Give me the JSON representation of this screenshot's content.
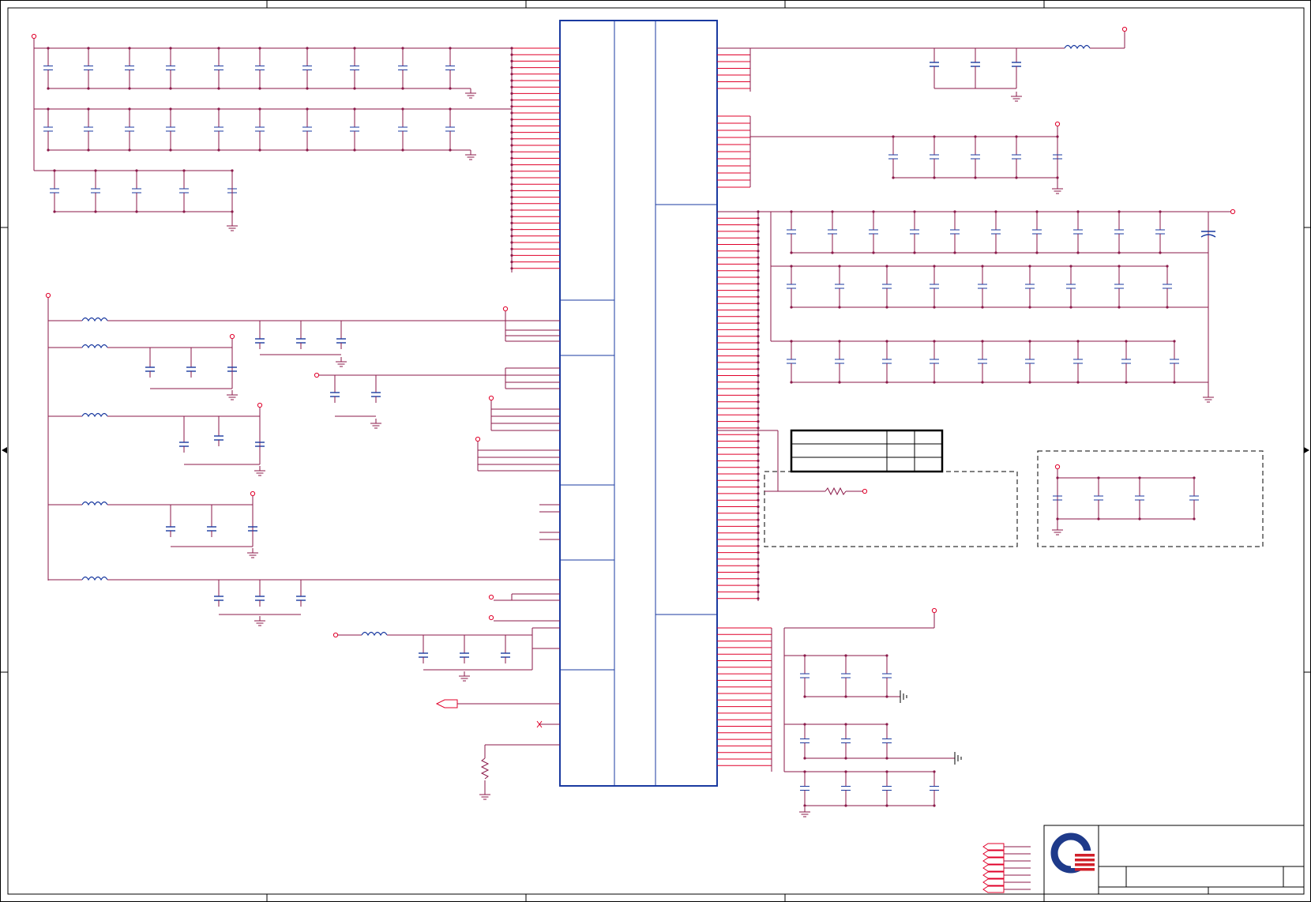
{
  "sheet": {
    "title": "",
    "zones": {
      "columns": [],
      "rows": []
    }
  },
  "ic": {
    "refdes": "",
    "part_number": ""
  },
  "title_block": {
    "logo": "company-logo",
    "title": "",
    "size": "",
    "document_number": "",
    "rev": "",
    "date": "",
    "sheet": ""
  },
  "table": {
    "rows": [
      [
        "",
        "",
        ""
      ],
      [
        "",
        "",
        ""
      ],
      [
        "",
        "",
        ""
      ]
    ]
  },
  "colors": {
    "wire": "#8b1a4a",
    "pin": "#e0002a",
    "component": "#1a3aa0",
    "border": "#000000",
    "logo_blue": "#1e3a8a",
    "logo_red": "#d0202a"
  }
}
